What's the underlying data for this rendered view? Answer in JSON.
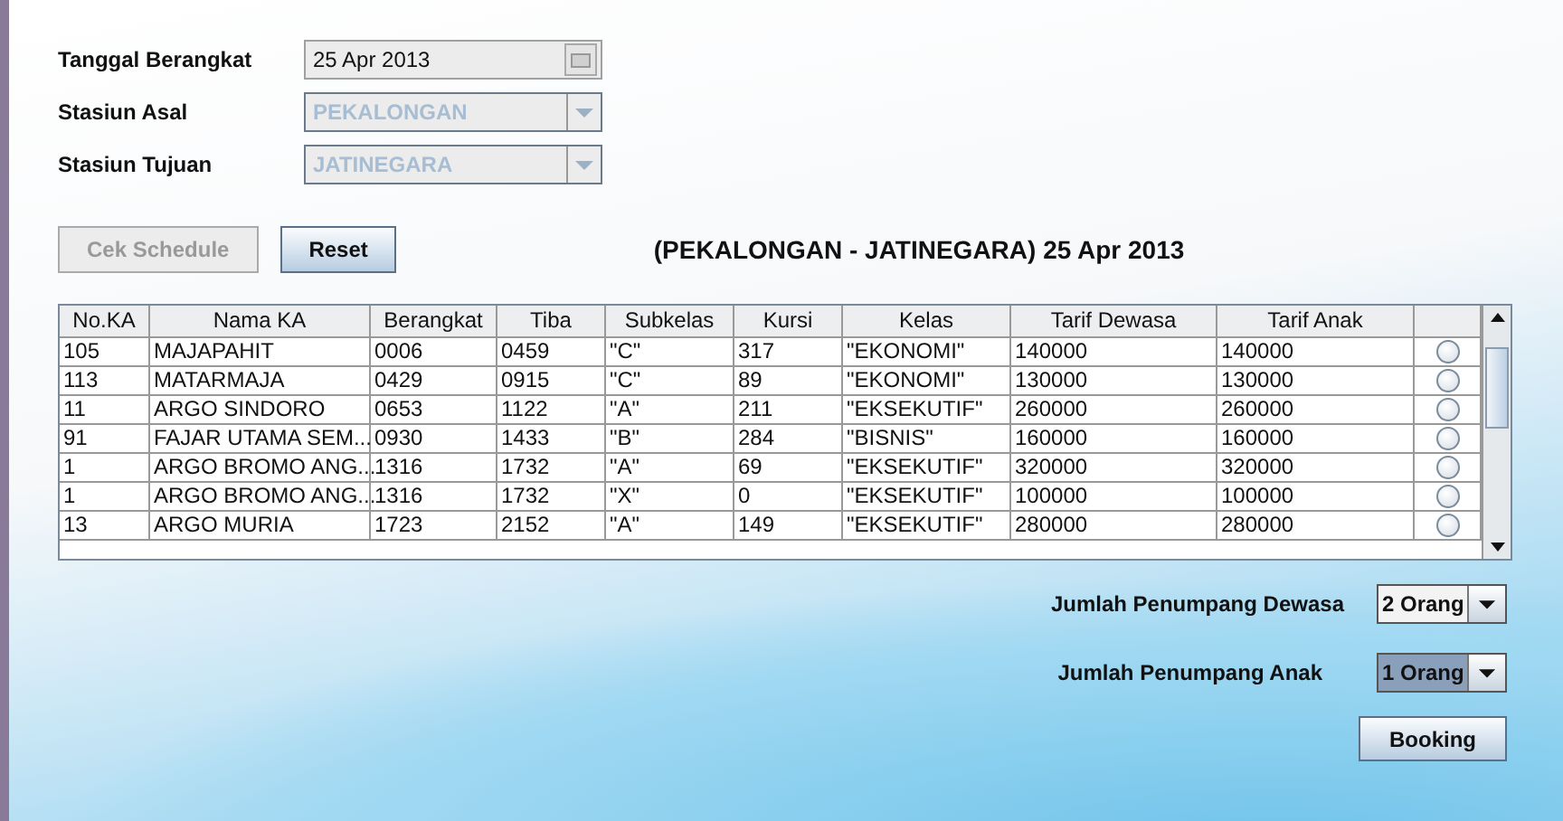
{
  "form": {
    "fields": [
      {
        "label": "Tanggal Berangkat",
        "kind": "date",
        "value": "25 Apr 2013",
        "disabled": false
      },
      {
        "label": "Stasiun Asal",
        "kind": "combo",
        "value": "PEKALONGAN",
        "disabled": true
      },
      {
        "label": "Stasiun Tujuan",
        "kind": "combo",
        "value": "JATINEGARA",
        "disabled": true
      }
    ]
  },
  "actions": [
    {
      "label": "Cek Schedule",
      "disabled": true
    },
    {
      "label": "Reset",
      "disabled": false
    }
  ],
  "route_title": "(PEKALONGAN - JATINEGARA) 25 Apr 2013",
  "table": {
    "columns": [
      "No.KA",
      "Nama KA",
      "Berangkat",
      "Tiba",
      "Subkelas",
      "Kursi",
      "Kelas",
      "Tarif Dewasa",
      "Tarif Anak"
    ],
    "rows": [
      {
        "cells": [
          "105",
          "MAJAPAHIT",
          "0006",
          "0459",
          "\"C\"",
          "317",
          "\"EKONOMI\"",
          "140000",
          "140000"
        ],
        "selected": false
      },
      {
        "cells": [
          "113",
          "MATARMAJA",
          "0429",
          "0915",
          "\"C\"",
          "89",
          "\"EKONOMI\"",
          "130000",
          "130000"
        ],
        "selected": false
      },
      {
        "cells": [
          "11",
          "ARGO SINDORO",
          "0653",
          "1122",
          "\"A\"",
          "211",
          "\"EKSEKUTIF\"",
          "260000",
          "260000"
        ],
        "selected": false
      },
      {
        "cells": [
          "91",
          "FAJAR UTAMA SEM...",
          "0930",
          "1433",
          "\"B\"",
          "284",
          "\"BISNIS\"",
          "160000",
          "160000"
        ],
        "selected": false
      },
      {
        "cells": [
          "1",
          "ARGO BROMO ANG...",
          "1316",
          "1732",
          "\"A\"",
          "69",
          "\"EKSEKUTIF\"",
          "320000",
          "320000"
        ],
        "selected": false
      },
      {
        "cells": [
          "1",
          "ARGO BROMO ANG...",
          "1316",
          "1732",
          "\"X\"",
          "0",
          "\"EKSEKUTIF\"",
          "100000",
          "100000"
        ],
        "selected": false
      },
      {
        "cells": [
          "13",
          "ARGO MURIA",
          "1723",
          "2152",
          "\"A\"",
          "149",
          "\"EKSEKUTIF\"",
          "280000",
          "280000"
        ],
        "selected": false
      }
    ]
  },
  "passengers": [
    {
      "label": "Jumlah Penumpang Dewasa",
      "value": "2 Orang",
      "focused": false
    },
    {
      "label": "Jumlah Penumpang Anak",
      "value": "1 Orang",
      "focused": true
    }
  ],
  "booking_button": "Booking"
}
